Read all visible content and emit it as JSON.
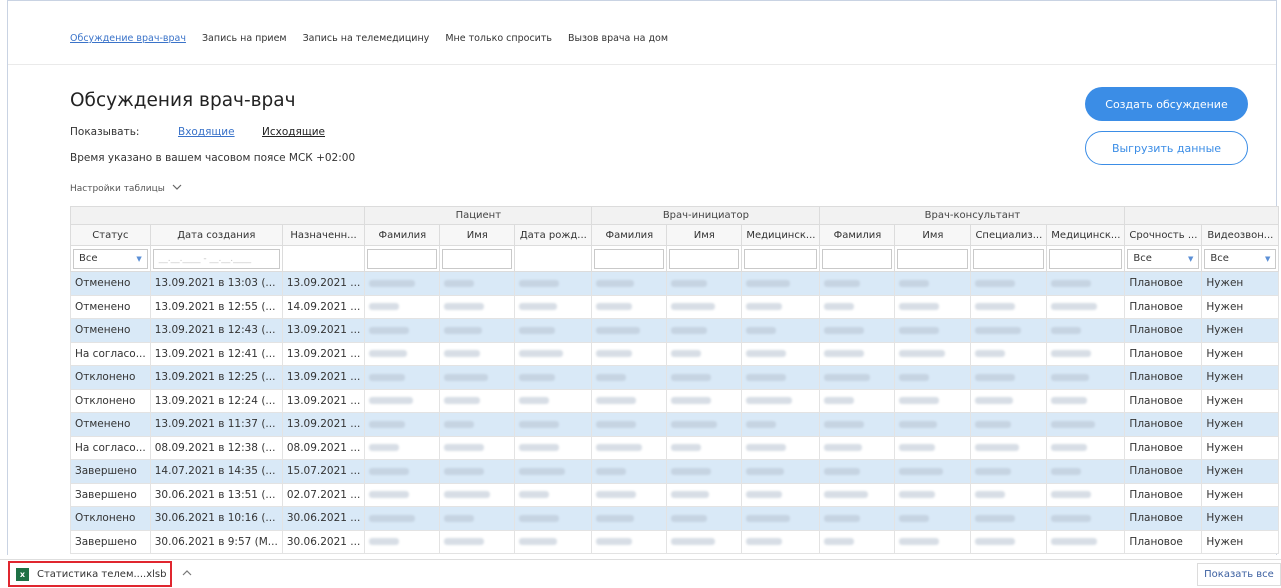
{
  "nav": {
    "tabs": [
      {
        "label": "Обсуждение врач-врач",
        "active": true
      },
      {
        "label": "Запись на прием",
        "active": false
      },
      {
        "label": "Запись на телемедицину",
        "active": false
      },
      {
        "label": "Мне только спросить",
        "active": false
      },
      {
        "label": "Вызов врача на дом",
        "active": false
      }
    ]
  },
  "page": {
    "title": "Обсуждения врач-врач",
    "show_label": "Показывать:",
    "incoming": "Входящие",
    "outgoing": "Исходящие",
    "timezone_note": "Время указано в вашем часовом поясе МСК +02:00",
    "table_settings": "Настройки таблицы",
    "create_button": "Создать обсуждение",
    "export_button": "Выгрузить данные"
  },
  "table": {
    "groups": {
      "patient": "Пациент",
      "initiator": "Врач-инициатор",
      "consultant": "Врач-консультант"
    },
    "headers": [
      "Статус",
      "Дата создания",
      "Назначенн...",
      "Фамилия",
      "Имя",
      "Дата рожд...",
      "Фамилия",
      "Имя",
      "Медицинск...",
      "Фамилия",
      "Имя",
      "Специализ...",
      "Медицинск...",
      "Срочность ...",
      "Видеозвон..."
    ],
    "filters": {
      "status": "Все",
      "urgency": "Все",
      "video": "Все",
      "date_placeholder": "__.__.____ - __.__.____"
    },
    "rows": [
      {
        "status": "Отменено",
        "created": "13.09.2021 в 13:03 (...",
        "assigned": "13.09.2021 ...",
        "urgency": "Плановое",
        "video": "Нужен"
      },
      {
        "status": "Отменено",
        "created": "13.09.2021 в 12:55 (...",
        "assigned": "14.09.2021 ...",
        "urgency": "Плановое",
        "video": "Нужен"
      },
      {
        "status": "Отменено",
        "created": "13.09.2021 в 12:43 (...",
        "assigned": "13.09.2021 ...",
        "urgency": "Плановое",
        "video": "Нужен"
      },
      {
        "status": "На согласо...",
        "created": "13.09.2021 в 12:41 (...",
        "assigned": "13.09.2021 ...",
        "urgency": "Плановое",
        "video": "Нужен"
      },
      {
        "status": "Отклонено",
        "created": "13.09.2021 в 12:25 (...",
        "assigned": "13.09.2021 ...",
        "urgency": "Плановое",
        "video": "Нужен"
      },
      {
        "status": "Отклонено",
        "created": "13.09.2021 в 12:24 (...",
        "assigned": "13.09.2021 ...",
        "urgency": "Плановое",
        "video": "Нужен"
      },
      {
        "status": "Отменено",
        "created": "13.09.2021 в 11:37 (...",
        "assigned": "13.09.2021 ...",
        "urgency": "Плановое",
        "video": "Нужен"
      },
      {
        "status": "На согласо...",
        "created": "08.09.2021 в 12:38 (...",
        "assigned": "08.09.2021 ...",
        "urgency": "Плановое",
        "video": "Нужен"
      },
      {
        "status": "Завершено",
        "created": "14.07.2021 в 14:35 (...",
        "assigned": "15.07.2021 ...",
        "urgency": "Плановое",
        "video": "Нужен"
      },
      {
        "status": "Завершено",
        "created": "30.06.2021 в 13:51 (...",
        "assigned": "02.07.2021 ...",
        "urgency": "Плановое",
        "video": "Нужен"
      },
      {
        "status": "Отклонено",
        "created": "30.06.2021 в 10:16 (...",
        "assigned": "30.06.2021 ...",
        "urgency": "Плановое",
        "video": "Нужен"
      },
      {
        "status": "Завершено",
        "created": "30.06.2021 в 9:57 (М...",
        "assigned": "30.06.2021 ...",
        "urgency": "Плановое",
        "video": "Нужен"
      }
    ]
  },
  "downloads": {
    "file_name": "Статистика телем....xlsb",
    "file_icon": "excel-icon",
    "show_all": "Показать все"
  }
}
